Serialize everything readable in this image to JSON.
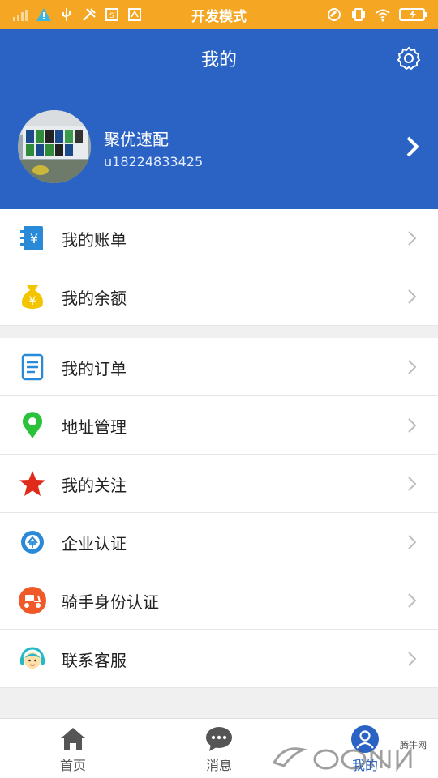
{
  "status_bar": {
    "mode": "开发模式"
  },
  "header": {
    "title": "我的",
    "user_name": "聚优速配",
    "user_id": "u18224833425"
  },
  "menu_group1": [
    {
      "label": "我的账单",
      "icon": "bill-icon"
    },
    {
      "label": "我的余额",
      "icon": "money-bag-icon"
    }
  ],
  "menu_group2": [
    {
      "label": "我的订单",
      "icon": "order-document-icon"
    },
    {
      "label": "地址管理",
      "icon": "location-pin-icon"
    },
    {
      "label": "我的关注",
      "icon": "star-icon"
    },
    {
      "label": "企业认证",
      "icon": "enterprise-badge-icon"
    },
    {
      "label": "骑手身份认证",
      "icon": "scooter-icon"
    },
    {
      "label": "联系客服",
      "icon": "customer-service-icon"
    }
  ],
  "bottom_nav": [
    {
      "label": "首页",
      "icon": "home-icon"
    },
    {
      "label": "消息",
      "icon": "chat-bubble-icon"
    },
    {
      "label": "我的",
      "icon": "user-icon"
    }
  ],
  "watermark": {
    "text": "腾牛网"
  },
  "colors": {
    "accent": "#2a63c4",
    "status_bar": "#f5a623"
  }
}
